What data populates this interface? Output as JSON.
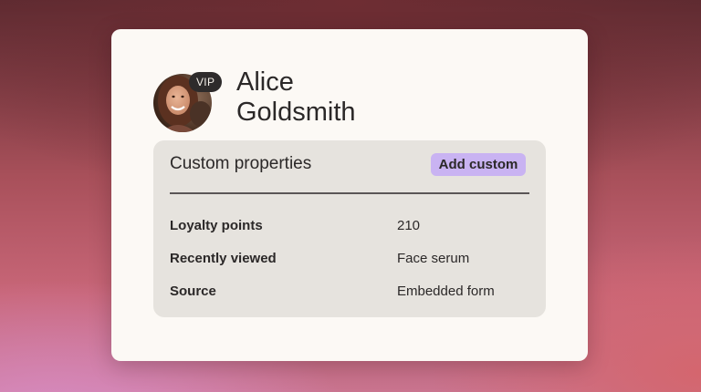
{
  "profile": {
    "badge": "VIP",
    "name": "Alice Goldsmith"
  },
  "custom_properties": {
    "title": "Custom properties",
    "add_button_label": "Add custom",
    "rows": [
      {
        "label": "Loyalty points",
        "value": "210"
      },
      {
        "label": "Recently viewed",
        "value": "Face serum"
      },
      {
        "label": "Source",
        "value": "Embedded form"
      }
    ]
  },
  "colors": {
    "card_background": "#fcf9f5",
    "panel_background": "#e6e3de",
    "accent_button": "#c9b3f2",
    "badge_background": "#2e2b2b",
    "text": "#2b2828"
  }
}
